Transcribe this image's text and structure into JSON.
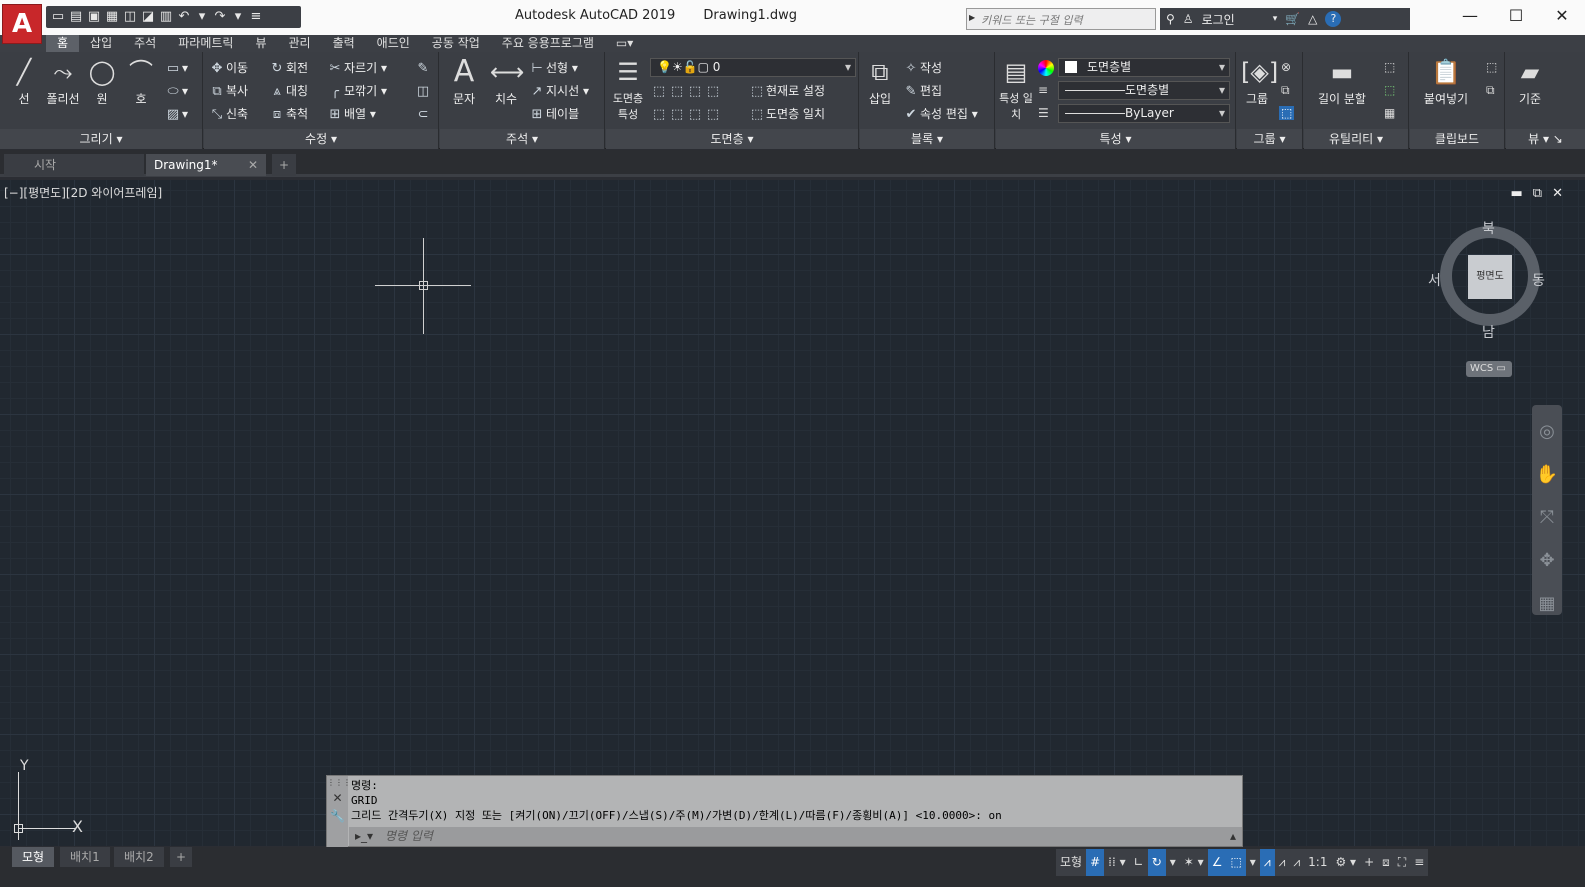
{
  "titlebar": {
    "app_title": "Autodesk AutoCAD 2019",
    "file_name": "Drawing1.dwg",
    "search_placeholder": "키워드 또는 구절 입력",
    "login_label": "로그인",
    "app_button": "A"
  },
  "qat_icons": [
    "new-icon",
    "open-icon",
    "save-icon",
    "saveas-icon",
    "web-open-icon",
    "web-save-icon",
    "plot-icon",
    "undo-icon",
    "redo-icon",
    "customize-icon"
  ],
  "ribbon_tabs": [
    "홈",
    "삽입",
    "주석",
    "파라메트릭",
    "뷰",
    "관리",
    "출력",
    "애드인",
    "공동 작업",
    "주요 응용프로그램"
  ],
  "panels": {
    "draw": {
      "title": "그리기",
      "tools": [
        "선",
        "폴리선",
        "원",
        "호"
      ]
    },
    "modify": {
      "title": "수정",
      "tools": [
        "이동",
        "회전",
        "자르기",
        "복사",
        "대칭",
        "모깎기",
        "신축",
        "축척",
        "배열"
      ]
    },
    "annotation": {
      "title": "주석",
      "tools": [
        "문자",
        "치수",
        "선형",
        "지시선",
        "테이블"
      ]
    },
    "layers": {
      "title": "도면층",
      "tools": [
        "도면층 특성",
        "현재로 설정",
        "도면층 일치"
      ],
      "layer_value": "0"
    },
    "block": {
      "title": "블록",
      "tools": [
        "삽입",
        "작성",
        "편집",
        "속성 편집"
      ]
    },
    "properties": {
      "title": "특성",
      "tools": [
        "특성 일치"
      ],
      "color": "도면층별",
      "linetype": "도면층별",
      "lineweight": "ByLayer"
    },
    "groups": {
      "title": "그룹",
      "tools": [
        "그룹"
      ]
    },
    "utilities": {
      "title": "유틸리티",
      "tools": [
        "길이 분할"
      ]
    },
    "clipboard": {
      "title": "클립보드",
      "tools": [
        "붙여넣기"
      ]
    },
    "view": {
      "title": "뷰",
      "tools": [
        "기준"
      ]
    }
  },
  "doc_tabs": [
    "시작",
    "Drawing1*"
  ],
  "viewport": {
    "label": "[−][평면도][2D 와이어프레임]",
    "viewcube": {
      "north": "북",
      "south": "남",
      "east": "동",
      "west": "서",
      "face": "평면도",
      "wcs": "WCS"
    },
    "ucs": {
      "x": "X",
      "y": "Y"
    }
  },
  "command": {
    "history": [
      "명령:",
      "GRID",
      "그리드 간격두기(X) 지정 또는 [켜기(ON)/끄기(OFF)/스냅(S)/주(M)/가변(D)/한계(L)/따름(F)/종횡비(A)] <10.0000>: on"
    ],
    "placeholder": "명령 입력"
  },
  "layout_tabs": [
    "모형",
    "배치1",
    "배치2"
  ],
  "statusbar": {
    "model": "모형",
    "scale": "1:1"
  },
  "colors": {
    "accent": "#c8272a",
    "canvas": "#212830",
    "active_toggle": "#2a6db5"
  }
}
